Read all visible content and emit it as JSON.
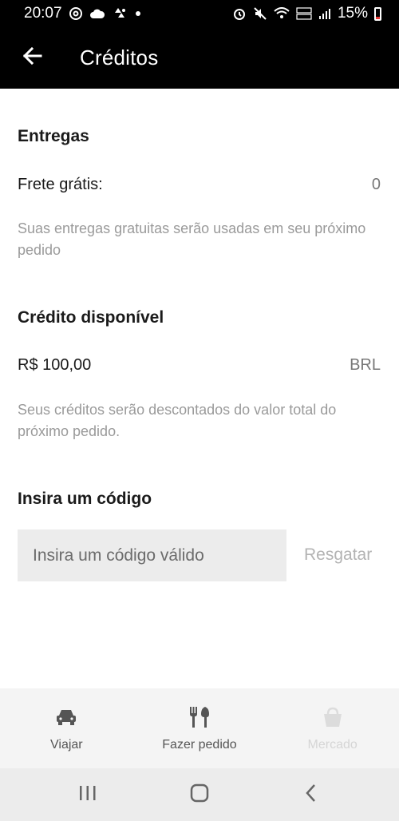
{
  "status_bar": {
    "time": "20:07",
    "battery": "15%",
    "icons_left": [
      "at-sign-icon",
      "cloud-icon",
      "pinwheel-icon",
      "dot-icon"
    ],
    "icons_right": [
      "alarm-icon",
      "mute-icon",
      "wifi-icon",
      "volte-icon",
      "signal-icon",
      "battery-low-icon"
    ]
  },
  "app_bar": {
    "title": "Créditos",
    "back_icon": "arrow-left-icon"
  },
  "deliveries": {
    "title": "Entregas",
    "label": "Frete grátis:",
    "value": "0",
    "help": "Suas entregas gratuitas serão usadas em seu próximo pedido"
  },
  "credit": {
    "title": "Crédito disponível",
    "amount": "R$ 100,00",
    "currency": "BRL",
    "help": "Seus créditos serão descontados do valor total do próximo pedido."
  },
  "code": {
    "title": "Insira um código",
    "placeholder": "Insira um código válido",
    "value": "",
    "redeem_label": "Resgatar"
  },
  "bottom_nav": {
    "items": [
      {
        "label": "Viajar",
        "icon": "car-icon",
        "enabled": true
      },
      {
        "label": "Fazer pedido",
        "icon": "fork-knife-icon",
        "enabled": true
      },
      {
        "label": "Mercado",
        "icon": "basket-icon",
        "enabled": false
      }
    ]
  },
  "system_nav": {
    "icons": [
      "recents-icon",
      "home-icon",
      "back-icon"
    ]
  },
  "colors": {
    "app_bar_bg": "#000000",
    "text_primary": "#1a1a1a",
    "text_muted": "#9a9a9a",
    "input_bg": "#ececec",
    "redeem_disabled": "#b3b3b3"
  }
}
